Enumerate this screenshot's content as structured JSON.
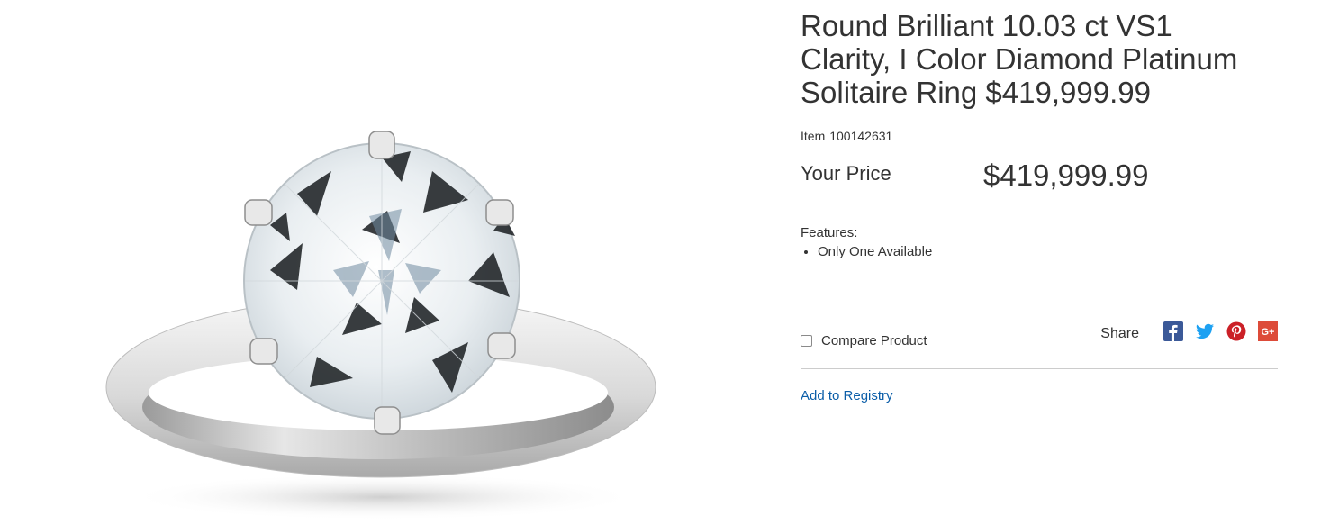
{
  "product": {
    "title": "Round Brilliant 10.03 ct VS1 Clarity, I Color Diamond Platinum Solitaire Ring $419,999.99",
    "image_alt": "Round brilliant diamond six-prong platinum solitaire ring",
    "item_label": "Item",
    "item_number": "100142631",
    "price_label": "Your Price",
    "price": "$419,999.99",
    "features_label": "Features:",
    "features": [
      "Only One Available"
    ]
  },
  "actions": {
    "compare_label": "Compare Product",
    "compare_checked": false,
    "share_label": "Share",
    "share_icons": [
      "facebook-icon",
      "twitter-icon",
      "pinterest-icon",
      "google-plus-icon"
    ],
    "registry_label": "Add to Registry"
  },
  "colors": {
    "text": "#333333",
    "link": "#0a5da8",
    "facebook": "#3b5998",
    "twitter": "#1da1f2",
    "pinterest": "#cb2027",
    "google_plus": "#dd4b39"
  }
}
